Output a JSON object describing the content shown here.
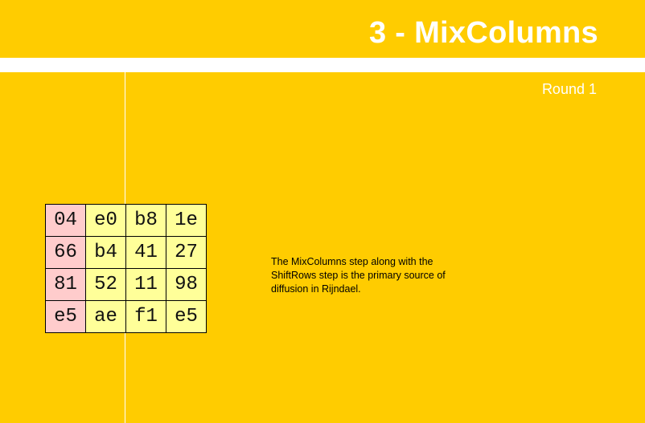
{
  "slide": {
    "title": "3 - MixColumns",
    "subtitle": "Round 1",
    "description": "The MixColumns step along with the ShiftRows step is the primary source of diffusion in Rijndael."
  },
  "state_matrix": [
    [
      "04",
      "e0",
      "b8",
      "1e"
    ],
    [
      "66",
      "b4",
      "41",
      "27"
    ],
    [
      "81",
      "52",
      "11",
      "98"
    ],
    [
      "e5",
      "ae",
      "f1",
      "e5"
    ]
  ],
  "colors": {
    "background": "#FFCC00",
    "highlight_column": "#FFCCCC",
    "cell": "#FFFF99"
  }
}
